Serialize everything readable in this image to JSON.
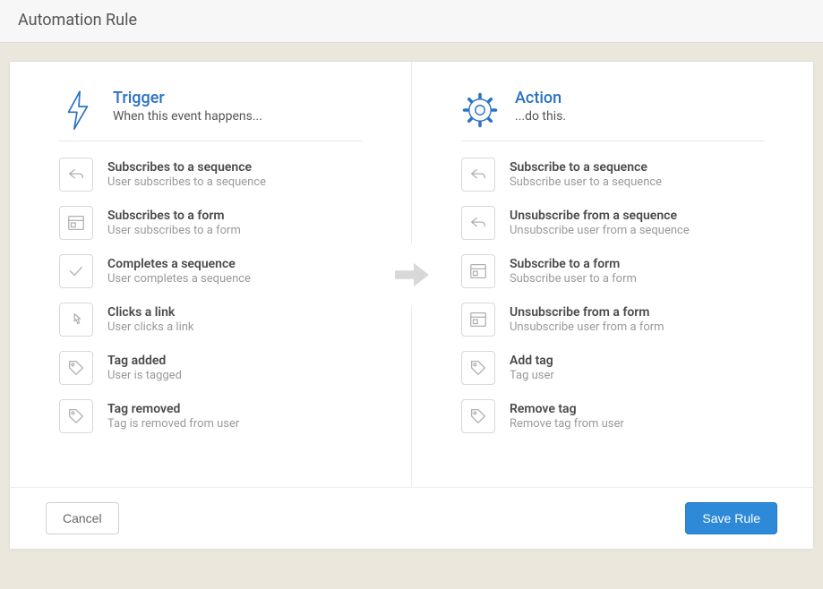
{
  "header": {
    "title": "Automation Rule"
  },
  "trigger": {
    "title": "Trigger",
    "subtitle": "When this event happens...",
    "items": [
      {
        "title": "Subscribes to a sequence",
        "desc": "User subscribes to a sequence",
        "icon": "reply"
      },
      {
        "title": "Subscribes to a form",
        "desc": "User subscribes to a form",
        "icon": "form"
      },
      {
        "title": "Completes a sequence",
        "desc": "User completes a sequence",
        "icon": "check"
      },
      {
        "title": "Clicks a link",
        "desc": "User clicks a link",
        "icon": "pointer"
      },
      {
        "title": "Tag added",
        "desc": "User is tagged",
        "icon": "tag"
      },
      {
        "title": "Tag removed",
        "desc": "Tag is removed from user",
        "icon": "tag"
      }
    ]
  },
  "action": {
    "title": "Action",
    "subtitle": "...do this.",
    "items": [
      {
        "title": "Subscribe to a sequence",
        "desc": "Subscribe user to a sequence",
        "icon": "reply"
      },
      {
        "title": "Unsubscribe from a sequence",
        "desc": "Unsubscribe user from a sequence",
        "icon": "reply"
      },
      {
        "title": "Subscribe to a form",
        "desc": "Subscribe user to a form",
        "icon": "form"
      },
      {
        "title": "Unsubscribe from a form",
        "desc": "Unsubscribe user from a form",
        "icon": "form"
      },
      {
        "title": "Add tag",
        "desc": "Tag user",
        "icon": "tag"
      },
      {
        "title": "Remove tag",
        "desc": "Remove tag from user",
        "icon": "tag"
      }
    ]
  },
  "buttons": {
    "cancel": "Cancel",
    "save": "Save Rule"
  }
}
